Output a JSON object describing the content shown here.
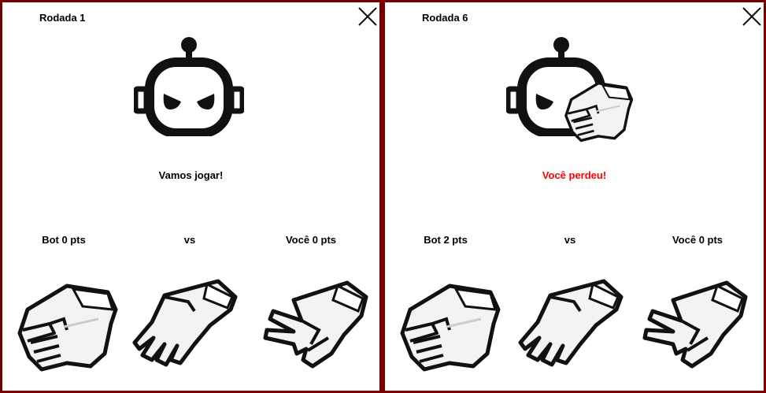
{
  "colors": {
    "frame": "#7a0000",
    "lose_text": "#ff0000",
    "win_text": "#000000"
  },
  "panels": [
    {
      "round_label": "Rodada 1",
      "message": "Vamos jogar!",
      "message_color": "#000000",
      "bot_score": "Bot 0 pts",
      "vs": "vs",
      "player_score": "Você 0 pts",
      "bot_choice": null
    },
    {
      "round_label": "Rodada 6",
      "message": "Você perdeu!",
      "message_color": "#ff0000",
      "bot_score": "Bot 2 pts",
      "vs": "vs",
      "player_score": "Você 0 pts",
      "bot_choice": "rock"
    }
  ],
  "choices": [
    "rock-hand-icon",
    "paper-hand-icon",
    "scissors-hand-icon"
  ]
}
